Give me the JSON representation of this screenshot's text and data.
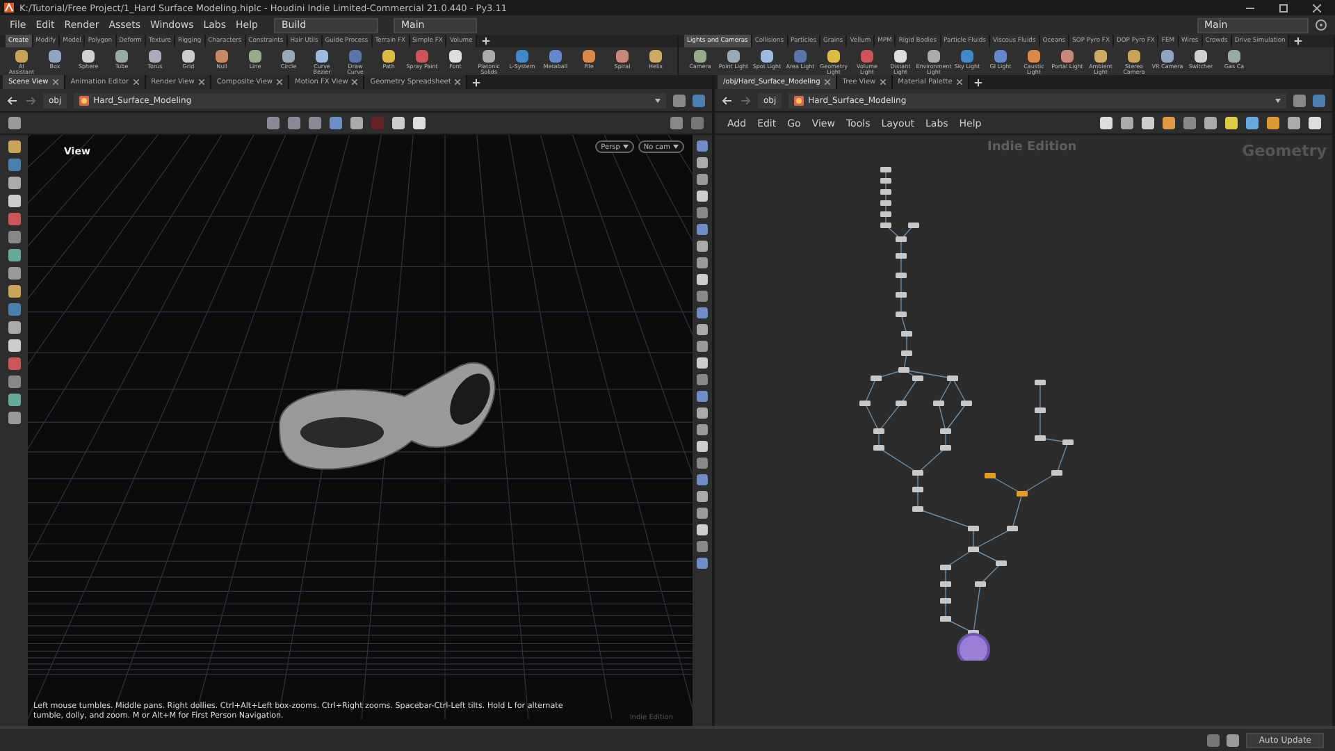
{
  "window": {
    "title": "K:/Tutorial/Free Project/1_Hard Surface Modeling.hiplc - Houdini Indie Limited-Commercial 21.0.440 - Py3.11"
  },
  "menu": [
    "File",
    "Edit",
    "Render",
    "Assets",
    "Windows",
    "Labs",
    "Help"
  ],
  "desks": [
    {
      "label": "Build"
    },
    {
      "label": "Main"
    }
  ],
  "right_desk": {
    "label": "Main"
  },
  "shelves": [
    {
      "tabs": [
        {
          "label": "Create",
          "selected": true
        },
        {
          "label": "Modify",
          "selected": false
        },
        {
          "label": "Model",
          "selected": false
        },
        {
          "label": "Polygon",
          "selected": false
        },
        {
          "label": "Deform",
          "selected": false
        },
        {
          "label": "Texture",
          "selected": false
        },
        {
          "label": "Rigging",
          "selected": false
        },
        {
          "label": "Characters",
          "selected": false
        },
        {
          "label": "Constraints",
          "selected": false
        },
        {
          "label": "Hair Utils",
          "selected": false
        },
        {
          "label": "Guide Process",
          "selected": false
        },
        {
          "label": "Terrain FX",
          "selected": false
        },
        {
          "label": "Simple FX",
          "selected": false
        },
        {
          "label": "Volume",
          "selected": false
        }
      ],
      "tools": [
        "AI Assistant",
        "Box",
        "Sphere",
        "Tube",
        "Torus",
        "Grid",
        "Null",
        "Line",
        "Circle",
        "Curve Bezier",
        "Draw Curve",
        "Path",
        "Spray Paint",
        "Font",
        "Platonic Solids",
        "L-System",
        "Metaball",
        "File",
        "Spiral",
        "Helix"
      ]
    },
    {
      "tabs": [
        {
          "label": "Lights and Cameras",
          "selected": true
        },
        {
          "label": "Collisions",
          "selected": false
        },
        {
          "label": "Particles",
          "selected": false
        },
        {
          "label": "Grains",
          "selected": false
        },
        {
          "label": "Vellum",
          "selected": false
        },
        {
          "label": "MPM",
          "selected": false
        },
        {
          "label": "Rigid Bodies",
          "selected": false
        },
        {
          "label": "Particle Fluids",
          "selected": false
        },
        {
          "label": "Viscous Fluids",
          "selected": false
        },
        {
          "label": "Oceans",
          "selected": false
        },
        {
          "label": "SOP Pyro FX",
          "selected": false
        },
        {
          "label": "DOP Pyro FX",
          "selected": false
        },
        {
          "label": "FEM",
          "selected": false
        },
        {
          "label": "Wires",
          "selected": false
        },
        {
          "label": "Crowds",
          "selected": false
        },
        {
          "label": "Drive Simulation",
          "selected": false
        }
      ],
      "tools": [
        "Camera",
        "Point Light",
        "Spot Light",
        "Area Light",
        "Geometry Light",
        "Volume Light",
        "Distant Light",
        "Environment Light",
        "Sky Light",
        "GI Light",
        "Caustic Light",
        "Portal Light",
        "Ambient Light",
        "Stereo Camera",
        "VR Camera",
        "Switcher",
        "Gas Ca"
      ]
    }
  ],
  "scene_pane": {
    "tabs": [
      {
        "label": "Scene View",
        "selected": true
      },
      {
        "label": "Animation Editor",
        "selected": false
      },
      {
        "label": "Render View",
        "selected": false
      },
      {
        "label": "Composite View",
        "selected": false
      },
      {
        "label": "Motion FX View",
        "selected": false
      },
      {
        "label": "Geometry Spreadsheet",
        "selected": false
      }
    ],
    "path": [
      "obj",
      "Hard_Surface_Modeling"
    ],
    "viewport": {
      "label": "View",
      "camera_buttons": [
        "Persp",
        "No cam"
      ],
      "hint": "Left mouse tumbles. Middle pans. Right dollies. Ctrl+Alt+Left box-zooms. Ctrl+Right zooms. Spacebar-Ctrl-Left tilts. Hold L for alternate tumble, dolly, and zoom. M or Alt+M for First Person Navigation.",
      "edition": "Indie Edition"
    }
  },
  "network_pane": {
    "tabs": [
      {
        "label": "/obj/Hard_Surface_Modeling",
        "selected": true
      },
      {
        "label": "Tree View",
        "selected": false
      },
      {
        "label": "Material Palette",
        "selected": false
      }
    ],
    "path": [
      "obj",
      "Hard_Surface_Modeling"
    ],
    "menu": [
      "Add",
      "Edit",
      "Go",
      "View",
      "Tools",
      "Layout",
      "Labs",
      "Help"
    ],
    "edition": "Indie Edition",
    "context": "Geometry"
  },
  "status_bar": {
    "button": "Auto Update"
  }
}
